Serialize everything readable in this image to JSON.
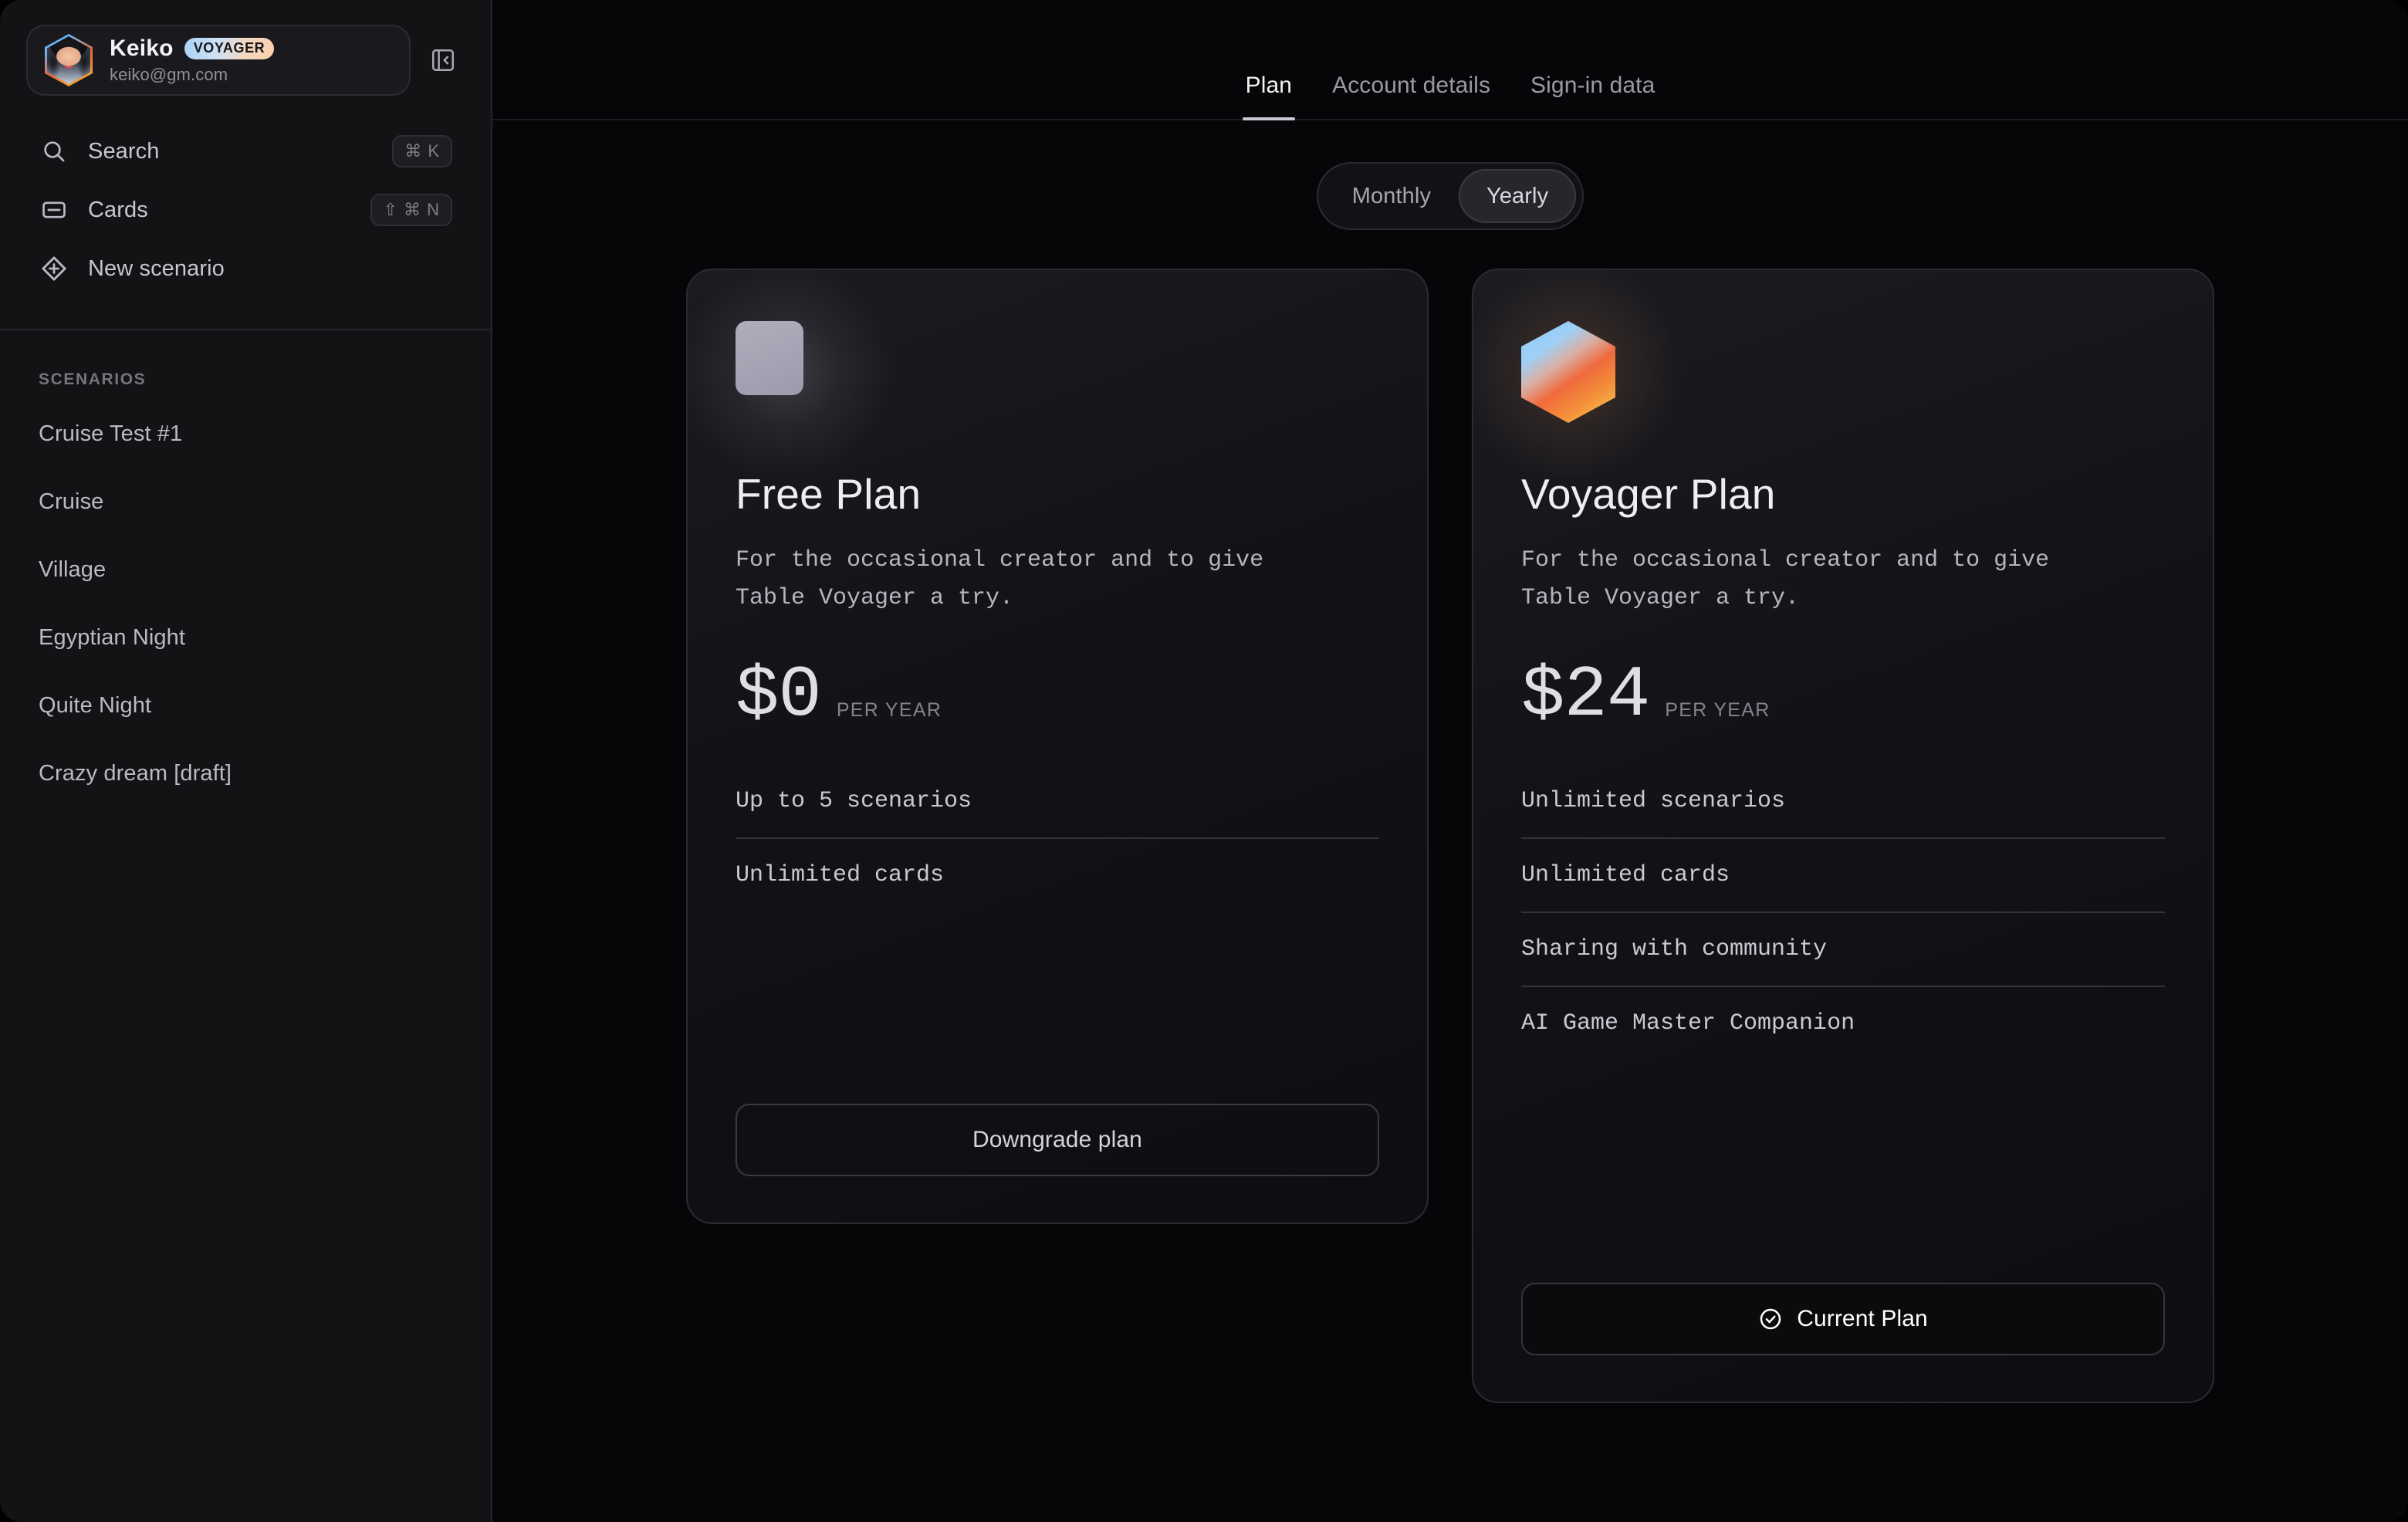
{
  "sidebar": {
    "user": {
      "name": "Keiko",
      "badge": "VOYAGER",
      "email": "keiko@gm.com",
      "avatar_icon": "user-avatar-hexagon"
    },
    "collapse_icon": "panel-collapse-left-icon",
    "nav": [
      {
        "label": "Search",
        "icon": "search-icon",
        "shortcut": "⌘ K"
      },
      {
        "label": "Cards",
        "icon": "card-icon",
        "shortcut": "⇧ ⌘ N"
      },
      {
        "label": "New scenario",
        "icon": "diamond-plus-icon",
        "shortcut": ""
      }
    ],
    "section_label": "SCENARIOS",
    "scenarios": [
      {
        "label": "Cruise Test #1"
      },
      {
        "label": "Cruise"
      },
      {
        "label": "Village"
      },
      {
        "label": "Egyptian Night"
      },
      {
        "label": "Quite Night"
      },
      {
        "label": "Crazy dream [draft]"
      }
    ]
  },
  "topbar": {
    "tabs": [
      {
        "label": "Plan",
        "active": true
      },
      {
        "label": "Account details",
        "active": false
      },
      {
        "label": "Sign-in data",
        "active": false
      }
    ]
  },
  "billing": {
    "monthly": "Monthly",
    "yearly": "Yearly",
    "selected": "Yearly"
  },
  "plans": [
    {
      "icon": "free-plan-square-icon",
      "name": "Free Plan",
      "description": "For the occasional creator and to give Table Voyager a try.",
      "price": "$0",
      "period": "PER YEAR",
      "features": [
        "Up to 5 scenarios",
        "Unlimited cards"
      ],
      "button": {
        "label": "Downgrade plan",
        "style": "outline",
        "icon": ""
      }
    },
    {
      "icon": "voyager-plan-hexagon-icon",
      "name": "Voyager Plan",
      "description": "For the occasional creator and to give Table Voyager a try.",
      "price": "$24",
      "period": "PER YEAR",
      "features": [
        "Unlimited scenarios",
        "Unlimited cards",
        "Sharing with community",
        "AI Game Master Companion"
      ],
      "button": {
        "label": "Current Plan",
        "style": "current",
        "icon": "check-circle-icon"
      }
    }
  ],
  "colors": {
    "page_bg": "#060608",
    "sidebar_bg": "#131316",
    "card_bg": "#15151a",
    "border": "#2b2b33",
    "text_primary": "#eeeef2",
    "text_secondary": "#9a9aa4",
    "accent_blue": "#8fc9f7",
    "accent_orange": "#ef6a3c",
    "accent_yellow": "#fbd25f"
  }
}
